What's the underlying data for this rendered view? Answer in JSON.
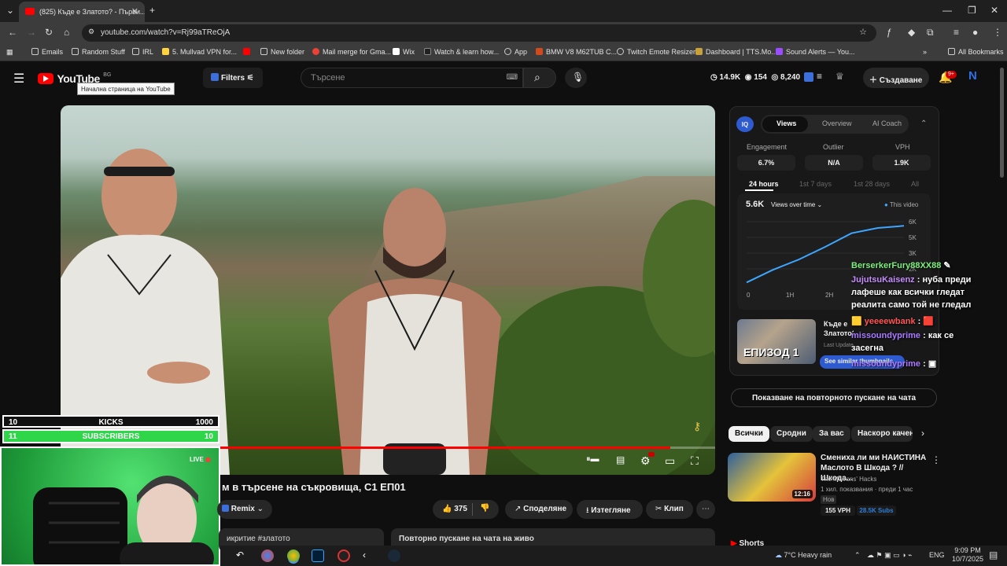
{
  "browser": {
    "tab_title": "(825) Къде е Златото? - Първи...",
    "url": "youtube.com/watch?v=Rj99aTReOjA",
    "bookmarks": [
      "Emails",
      "Random Stuff",
      "IRL",
      "5. Mullvad VPN for...",
      "New folder",
      "Mail merge for Gma...",
      "Wix",
      "Watch & learn how...",
      "App",
      "BMW V8 M62TUB C...",
      "Twitch Emote Resizer",
      "Dashboard | TTS.Mo...",
      "Sound Alerts — You...",
      "All Bookmarks"
    ]
  },
  "yt": {
    "logo_text": "YouTube",
    "logo_region": "BG",
    "tooltip": "Начална страница на YouTube",
    "filters_label": "Filters",
    "search_placeholder": "Търсене",
    "stat_time": "14.9K",
    "stat_eye": "154",
    "stat_views": "8,240",
    "create_label": "Създаване",
    "notif_badge": "9+",
    "avatar_letter": "N"
  },
  "overlay": {
    "kicks_left": "10",
    "kicks_label": "KICKS",
    "kicks_right": "1000",
    "subs_left": "11",
    "subs_label": "SUBSCRIBERS",
    "subs_right": "10",
    "subs_progress": 1.0,
    "live_label": "LIVE"
  },
  "video": {
    "title": "м в търсене на съкровища, С1 ЕП01",
    "progress_fraction": 0.91,
    "remix_label": "Remix",
    "likes": "375",
    "share_label": "Споделяне",
    "download_label": "Изтегляне",
    "clip_label": "Клип",
    "desc_left": "икритие #златото",
    "desc_right": "Повторно пускане на чата на живо"
  },
  "iq": {
    "badge": "IQ",
    "tabs": [
      "Views",
      "Overview",
      "AI Coach"
    ],
    "metrics": [
      {
        "label": "Engagement",
        "value": "6.7%"
      },
      {
        "label": "Outlier",
        "value": "N/A"
      },
      {
        "label": "VPH",
        "value": "1.9K"
      }
    ],
    "ranges": [
      "24 hours",
      "1st 7 days",
      "1st 28 days",
      "All"
    ],
    "views_total": "5.6K",
    "views_dropdown": "Views over time",
    "legend": "This video",
    "promo_title": "Къде е Златото? - Първи... седем в търсене на...",
    "promo_sub": "Last Update...",
    "promo_btn": "See similar thumbnails",
    "thumb_text": "ЕПИЗОД 1"
  },
  "chart_data": {
    "type": "line",
    "x": [
      "0",
      "1H",
      "2H"
    ],
    "yticks": [
      "6K",
      "5K",
      "3K",
      "2K"
    ],
    "series": [
      {
        "values": [
          0.2,
          1.4,
          2.4,
          3.6,
          4.9,
          5.4,
          5.6
        ]
      }
    ],
    "ylim": [
      0,
      6000
    ]
  },
  "chat": [
    {
      "user": "BerserkerFury88XX88",
      "msg": ""
    },
    {
      "user": "JujutsuKaisenz",
      "msg": "нуба преди лафеше как всички гледат реалита само той не гледал"
    },
    {
      "user": "yeeeewbank",
      "msg": ""
    },
    {
      "user": "missoundyprime",
      "msg": "как се засегна"
    },
    {
      "user": "missoundyprime",
      "msg": ""
    }
  ],
  "side": {
    "replay_chat": "Показване на повторното пускане на чата",
    "chips": [
      "Всички",
      "Сродни",
      "За вас",
      "Наскоро качени"
    ],
    "rec_title": "Сменихa ли ми НАИСТИНА Маслото В Шкода ? // Шкода...",
    "rec_channel": "The Morrons' Hacks",
    "rec_meta": "1 хил. показвания · преди 1 час",
    "rec_new": "Нов",
    "rec_vph": "155 VPH",
    "rec_subs": "28.5K Subs",
    "rec_duration": "12:16",
    "shorts": "Shorts"
  },
  "taskbar": {
    "weather": "7°C  Heavy rain",
    "lang": "ENG",
    "time": "9:09 PM",
    "date": "10/7/2025"
  }
}
